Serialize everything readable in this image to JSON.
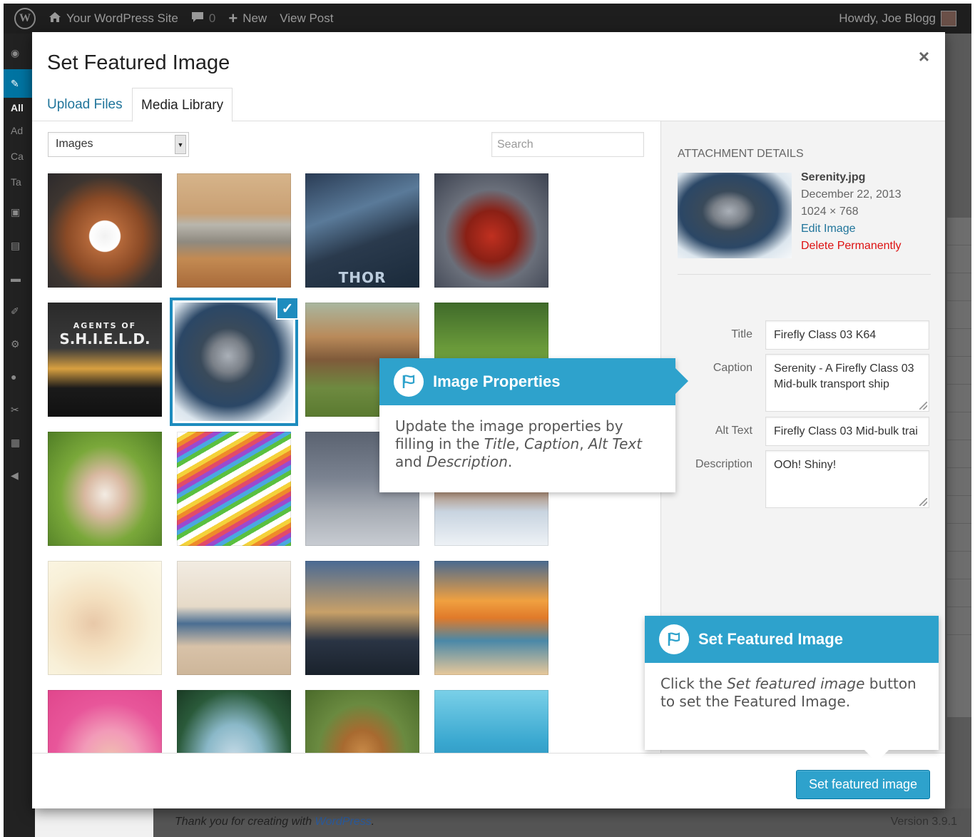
{
  "adminbar": {
    "site_name": "Your WordPress Site",
    "comments_count": "0",
    "new_label": "New",
    "view_post": "View Post",
    "howdy": "Howdy, Joe Blogg"
  },
  "sidemenu": {
    "sub_items": [
      "All",
      "Ad",
      "Ca",
      "Ta"
    ]
  },
  "footer": {
    "thanks_prefix": "Thank you for creating with ",
    "thanks_link": "WordPress",
    "thanks_suffix": ".",
    "version": "Version 3.9.1"
  },
  "modal": {
    "title": "Set Featured Image",
    "close": "×",
    "tabs": [
      "Upload Files",
      "Media Library"
    ],
    "filter_value": "Images",
    "search_placeholder": "Search",
    "button_label": "Set featured image"
  },
  "grid": {
    "thumbnails": [
      {
        "name": "boxer-dog"
      },
      {
        "name": "mars-rover"
      },
      {
        "name": "thor-poster",
        "label": "THOR"
      },
      {
        "name": "iron-man"
      },
      {
        "name": "shield-poster",
        "label": "S.H.I.E.L.D.",
        "sublabel": "AGENTS OF"
      },
      {
        "name": "serenity-ship",
        "selected": true
      },
      {
        "name": "boxer-puppy-grass"
      },
      {
        "name": "cat-grass"
      },
      {
        "name": "bulldog-puppies"
      },
      {
        "name": "colored-pencils"
      },
      {
        "name": "bicycle"
      },
      {
        "name": "horse-snow"
      },
      {
        "name": "woman-headphones"
      },
      {
        "name": "feet-beach"
      },
      {
        "name": "lighthouse"
      },
      {
        "name": "sunset-sea"
      },
      {
        "name": "bubblegum-girl"
      },
      {
        "name": "cave-beach"
      },
      {
        "name": "beagle-puppy"
      },
      {
        "name": "sea-turtle"
      }
    ]
  },
  "attachment": {
    "heading": "Attachment Details",
    "filename": "Serenity.jpg",
    "date": "December 22, 2013",
    "dimensions": "1024 × 768",
    "edit_link": "Edit Image",
    "delete_link": "Delete Permanently",
    "fields": {
      "title_label": "Title",
      "title_value": "Firefly Class 03 K64",
      "caption_label": "Caption",
      "caption_value": "Serenity - A Firefly Class 03 Mid-bulk transport ship",
      "alt_label": "Alt Text",
      "alt_value": "Firefly Class 03 Mid-bulk trai",
      "desc_label": "Description",
      "desc_value": "OOh! Shiny!"
    }
  },
  "tooltips": {
    "properties": {
      "title": "Image Properties",
      "text_1": "Update the image properties by filling in the ",
      "em_1": "Title",
      "text_2": ", ",
      "em_2": "Caption",
      "text_3": ", ",
      "em_3": "Alt Text",
      "text_4": " and ",
      "em_4": "Description",
      "text_5": "."
    },
    "featured": {
      "title": "Set Featured Image",
      "text_1": "Click the ",
      "em_1": "Set featured image",
      "text_2": " button to set the Featured Image."
    }
  },
  "colors": {
    "accent": "#2ea2cc",
    "admin_active": "#0074a2",
    "delete": "#dd1111",
    "link": "#21759b"
  }
}
